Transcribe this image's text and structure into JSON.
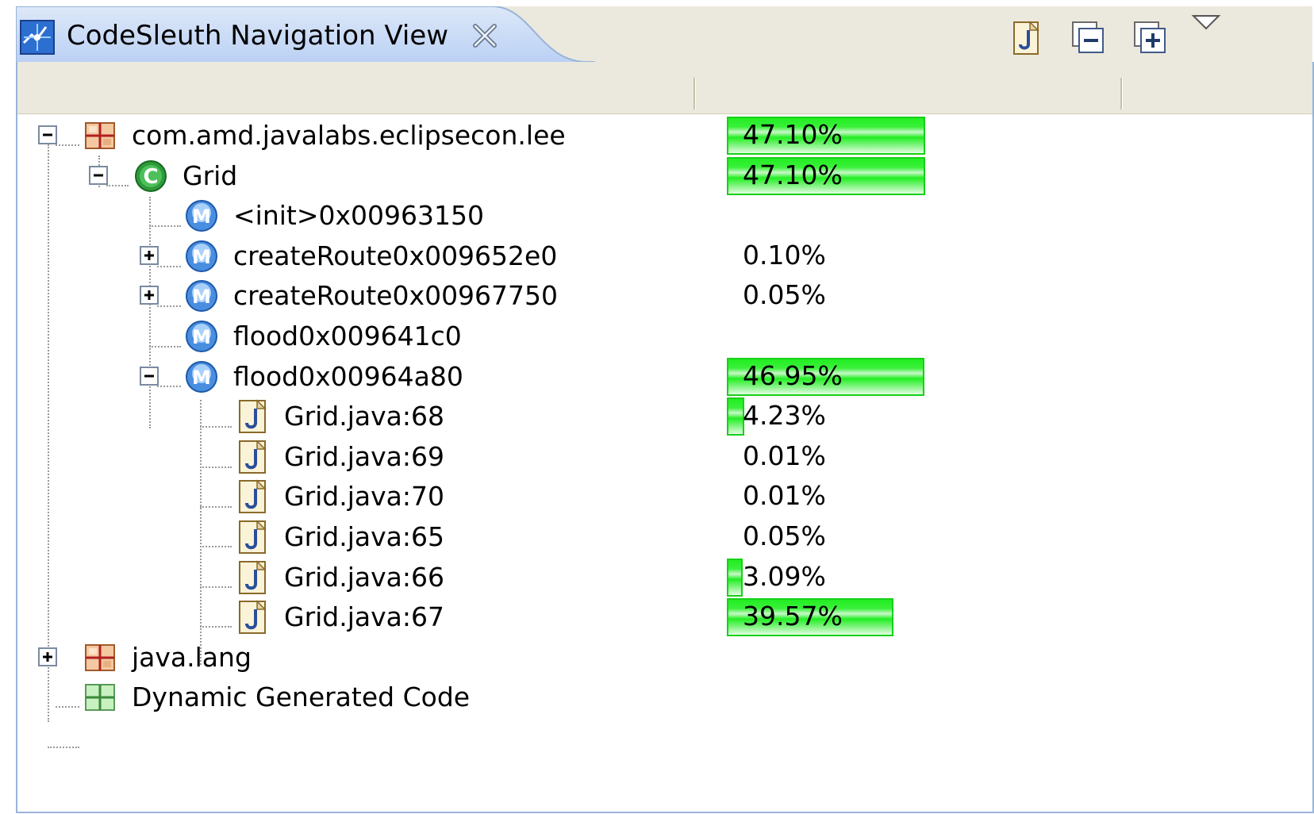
{
  "view": {
    "title": "CodeSleuth Navigation View",
    "toolbar": [
      "java-file-icon",
      "collapse-all-icon",
      "expand-all-icon",
      "view-menu-icon"
    ]
  },
  "tree": {
    "rows": [
      {
        "label": "com.amd.javalabs.eclipsecon.lee",
        "percent": "47.10%",
        "fraction": 0.471,
        "icon": "package-icon",
        "expander": "collapse",
        "depth": 0
      },
      {
        "label": "Grid",
        "percent": "47.10%",
        "fraction": 0.471,
        "icon": "class-icon",
        "expander": "collapse",
        "depth": 1
      },
      {
        "label": "<init>0x00963150",
        "percent": "",
        "fraction": 0,
        "icon": "method-icon",
        "expander": "none",
        "depth": 2
      },
      {
        "label": "createRoute0x009652e0",
        "percent": "0.10%",
        "fraction": 0.001,
        "icon": "method-icon",
        "expander": "expand",
        "depth": 2
      },
      {
        "label": "createRoute0x00967750",
        "percent": "0.05%",
        "fraction": 0.0005,
        "icon": "method-icon",
        "expander": "expand",
        "depth": 2
      },
      {
        "label": "flood0x009641c0",
        "percent": "",
        "fraction": 0,
        "icon": "method-icon",
        "expander": "none",
        "depth": 2
      },
      {
        "label": "flood0x00964a80",
        "percent": "46.95%",
        "fraction": 0.4695,
        "icon": "method-icon",
        "expander": "collapse",
        "depth": 2
      },
      {
        "label": "Grid.java:68",
        "percent": "4.23%",
        "fraction": 0.0423,
        "icon": "java-file-icon",
        "expander": "none",
        "depth": 3
      },
      {
        "label": "Grid.java:69",
        "percent": "0.01%",
        "fraction": 0.0001,
        "icon": "java-file-icon",
        "expander": "none",
        "depth": 3
      },
      {
        "label": "Grid.java:70",
        "percent": "0.01%",
        "fraction": 0.0001,
        "icon": "java-file-icon",
        "expander": "none",
        "depth": 3
      },
      {
        "label": "Grid.java:65",
        "percent": "0.05%",
        "fraction": 0.0005,
        "icon": "java-file-icon",
        "expander": "none",
        "depth": 3
      },
      {
        "label": "Grid.java:66",
        "percent": "3.09%",
        "fraction": 0.0309,
        "icon": "java-file-icon",
        "expander": "none",
        "depth": 3
      },
      {
        "label": "Grid.java:67",
        "percent": "39.57%",
        "fraction": 0.3957,
        "icon": "java-file-icon",
        "expander": "none",
        "depth": 3
      },
      {
        "label": "java.lang",
        "percent": "",
        "fraction": 0,
        "icon": "package-icon",
        "expander": "expand",
        "depth": 0
      },
      {
        "label": "Dynamic Generated Code",
        "percent": "",
        "fraction": 0,
        "icon": "generated-package-icon",
        "expander": "none",
        "depth": 0
      }
    ]
  },
  "colors": {
    "bar_fill": "#22ee22",
    "bar_border": "#18d018",
    "tab_active": "#c6d9f7",
    "frame_border": "#98b4d8",
    "header_bg": "#ebe9dd"
  }
}
